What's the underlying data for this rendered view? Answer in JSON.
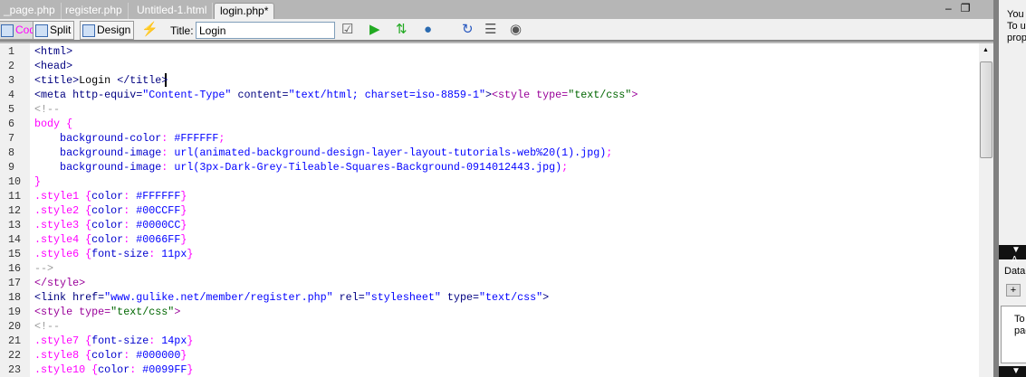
{
  "tabs": [
    {
      "label": "_page.php"
    },
    {
      "label": "register.php"
    },
    {
      "label": "Untitled-1.html"
    },
    {
      "label": "login.php*"
    }
  ],
  "window_controls": {
    "minimize": "–",
    "restore": "❐"
  },
  "toolbar": {
    "code": "Code",
    "split": "Split",
    "design": "Design",
    "title_label": "Title:",
    "title_value": "Login"
  },
  "code_lines": [
    [
      [
        "<html>",
        "tag"
      ]
    ],
    [
      [
        "<head>",
        "tag"
      ]
    ],
    [
      [
        "<title>",
        "tag"
      ],
      [
        "Login ",
        ""
      ],
      [
        "</title>",
        "tag"
      ]
    ],
    [
      [
        "<meta http-equiv=",
        "tag"
      ],
      [
        "\"Content-Type\"",
        "str"
      ],
      [
        " content=",
        "tag"
      ],
      [
        "\"text/html; charset=iso-8859-1\"",
        "str"
      ],
      [
        ">",
        "tag"
      ],
      [
        "<style type=",
        "sty"
      ],
      [
        "\"text/css\"",
        "grn"
      ],
      [
        ">",
        "sty"
      ]
    ],
    [
      [
        "<!--",
        "cm"
      ]
    ],
    [
      [
        "body {",
        "sel"
      ]
    ],
    [
      [
        "    background-color",
        "prop"
      ],
      [
        ": ",
        "sel"
      ],
      [
        "#FFFFFF",
        "val"
      ],
      [
        ";",
        "sel"
      ]
    ],
    [
      [
        "    background-image",
        "prop"
      ],
      [
        ": ",
        "sel"
      ],
      [
        "url(animated-background-design-layer-layout-tutorials-web%20(1).jpg)",
        "val"
      ],
      [
        ";",
        "sel"
      ]
    ],
    [
      [
        "    background-image",
        "prop"
      ],
      [
        ": ",
        "sel"
      ],
      [
        "url(3px-Dark-Grey-Tileable-Squares-Background-0914012443.jpg)",
        "val"
      ],
      [
        ";",
        "sel"
      ]
    ],
    [
      [
        "}",
        "sel"
      ]
    ],
    [
      [
        ".style1 {",
        "sel"
      ],
      [
        "color",
        "prop"
      ],
      [
        ": ",
        "sel"
      ],
      [
        "#FFFFFF",
        "val"
      ],
      [
        "}",
        "sel"
      ]
    ],
    [
      [
        ".style2 {",
        "sel"
      ],
      [
        "color",
        "prop"
      ],
      [
        ": ",
        "sel"
      ],
      [
        "#00CCFF",
        "val"
      ],
      [
        "}",
        "sel"
      ]
    ],
    [
      [
        ".style3 {",
        "sel"
      ],
      [
        "color",
        "prop"
      ],
      [
        ": ",
        "sel"
      ],
      [
        "#0000CC",
        "val"
      ],
      [
        "}",
        "sel"
      ]
    ],
    [
      [
        ".style4 {",
        "sel"
      ],
      [
        "color",
        "prop"
      ],
      [
        ": ",
        "sel"
      ],
      [
        "#0066FF",
        "val"
      ],
      [
        "}",
        "sel"
      ]
    ],
    [
      [
        ".style6 {",
        "sel"
      ],
      [
        "font-size",
        "prop"
      ],
      [
        ": ",
        "sel"
      ],
      [
        "11px",
        "val"
      ],
      [
        "}",
        "sel"
      ]
    ],
    [
      [
        "-->",
        "cm"
      ]
    ],
    [
      [
        "</style>",
        "sty"
      ]
    ],
    [
      [
        "<link href=",
        "tag"
      ],
      [
        "\"www.gulike.net/member/register.php\"",
        "str"
      ],
      [
        " rel=",
        "tag"
      ],
      [
        "\"stylesheet\"",
        "str"
      ],
      [
        " type=",
        "tag"
      ],
      [
        "\"text/css\"",
        "str"
      ],
      [
        ">",
        "tag"
      ]
    ],
    [
      [
        "<style type=",
        "sty"
      ],
      [
        "\"text/css\"",
        "grn"
      ],
      [
        ">",
        "sty"
      ]
    ],
    [
      [
        "<!--",
        "cm"
      ]
    ],
    [
      [
        ".style7 {",
        "sel"
      ],
      [
        "font-size",
        "prop"
      ],
      [
        ": ",
        "sel"
      ],
      [
        "14px",
        "val"
      ],
      [
        "}",
        "sel"
      ]
    ],
    [
      [
        ".style8 {",
        "sel"
      ],
      [
        "color",
        "prop"
      ],
      [
        ": ",
        "sel"
      ],
      [
        "#000000",
        "val"
      ],
      [
        "}",
        "sel"
      ]
    ],
    [
      [
        ".style10 {",
        "sel"
      ],
      [
        "color",
        "prop"
      ],
      [
        ": ",
        "sel"
      ],
      [
        "#0099FF",
        "val"
      ],
      [
        "}",
        "sel"
      ]
    ]
  ],
  "panel": {
    "line1": "You",
    "line2": "To u",
    "line3": "prop",
    "header1": "A",
    "data_label": "Data",
    "hint1": "To",
    "hint2": "pag",
    "header2": "T"
  }
}
